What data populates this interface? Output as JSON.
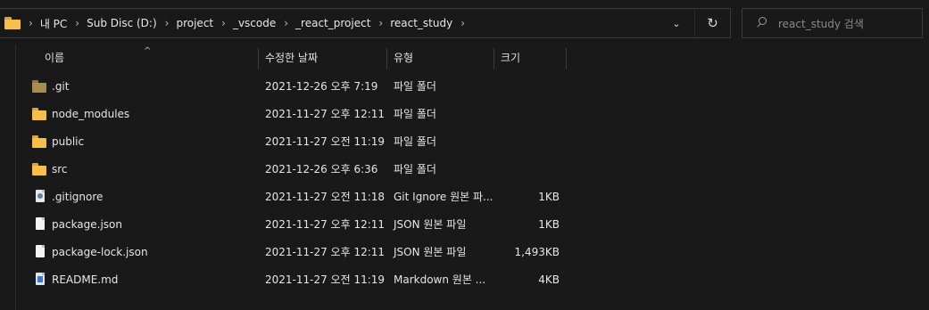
{
  "address": {
    "crumbs": [
      "내 PC",
      "Sub Disc (D:)",
      "project",
      "_vscode",
      "_react_project",
      "react_study"
    ],
    "separator": "›",
    "history_chevron": "⌄",
    "refresh": "↻"
  },
  "search": {
    "placeholder": "react_study 검색"
  },
  "columns": {
    "name": "이름",
    "date": "수정한 날짜",
    "type": "유형",
    "size": "크기",
    "sort_indicator": "^"
  },
  "files": [
    {
      "name": ".git",
      "date": "2021-12-26 오후 7:19",
      "type": "파일 폴더",
      "size": "",
      "icon": "folder-dim-icon"
    },
    {
      "name": "node_modules",
      "date": "2021-11-27 오후 12:11",
      "type": "파일 폴더",
      "size": "",
      "icon": "folder-icon"
    },
    {
      "name": "public",
      "date": "2021-11-27 오전 11:19",
      "type": "파일 폴더",
      "size": "",
      "icon": "folder-icon"
    },
    {
      "name": "src",
      "date": "2021-12-26 오후 6:36",
      "type": "파일 폴더",
      "size": "",
      "icon": "folder-icon"
    },
    {
      "name": ".gitignore",
      "date": "2021-11-27 오전 11:18",
      "type": "Git Ignore 원본 파...",
      "size": "1KB",
      "icon": "gitignore-file-icon"
    },
    {
      "name": "package.json",
      "date": "2021-11-27 오후 12:11",
      "type": "JSON 원본 파일",
      "size": "1KB",
      "icon": "file-icon"
    },
    {
      "name": "package-lock.json",
      "date": "2021-11-27 오후 12:11",
      "type": "JSON 원본 파일",
      "size": "1,493KB",
      "icon": "file-icon"
    },
    {
      "name": "README.md",
      "date": "2021-11-27 오전 11:19",
      "type": "Markdown 원본 ...",
      "size": "4KB",
      "icon": "markdown-file-icon"
    }
  ]
}
